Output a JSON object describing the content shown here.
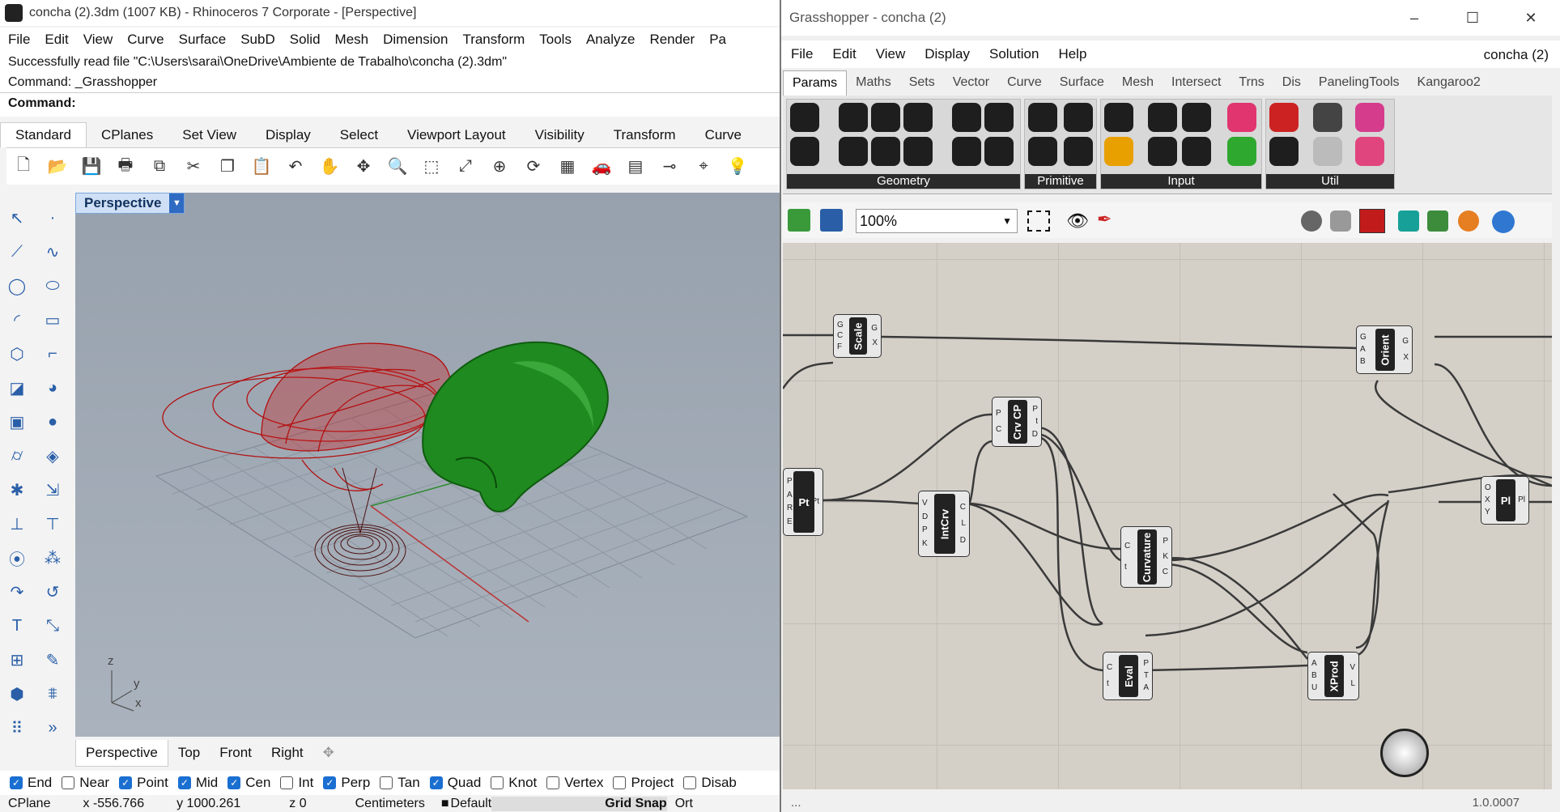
{
  "rhino": {
    "title": "concha (2).3dm (1007 KB) - Rhinoceros 7 Corporate - [Perspective]",
    "menu": [
      "File",
      "Edit",
      "View",
      "Curve",
      "Surface",
      "SubD",
      "Solid",
      "Mesh",
      "Dimension",
      "Transform",
      "Tools",
      "Analyze",
      "Render",
      "Pa"
    ],
    "command_history": [
      "Successfully read file \"C:\\Users\\sarai\\OneDrive\\Ambiente de Trabalho\\concha (2).3dm\"",
      "Command: _Grasshopper"
    ],
    "command_prompt": "Command:",
    "toolbar_tabs": [
      "Standard",
      "CPlanes",
      "Set View",
      "Display",
      "Select",
      "Viewport Layout",
      "Visibility",
      "Transform",
      "Curve"
    ],
    "toolbar_icons": [
      "new-icon",
      "open-icon",
      "save-icon",
      "print-icon",
      "import-icon",
      "cut-icon",
      "copy-icon",
      "paste-icon",
      "undo-icon",
      "pan-icon",
      "rotate-view-icon",
      "zoom-icon",
      "zoom-window-icon",
      "zoom-extents-icon",
      "zoom-selected-icon",
      "rotate-icon",
      "viewport-layout-icon",
      "car-icon",
      "grid-icon",
      "dimension-icon",
      "snap-icon",
      "light-icon"
    ],
    "viewport_label": "Perspective",
    "axis_labels": {
      "z": "z",
      "y": "y",
      "x": "x"
    },
    "view_tabs": [
      "Perspective",
      "Top",
      "Front",
      "Right"
    ],
    "osnaps": [
      {
        "label": "End",
        "checked": true
      },
      {
        "label": "Near",
        "checked": false
      },
      {
        "label": "Point",
        "checked": true
      },
      {
        "label": "Mid",
        "checked": true
      },
      {
        "label": "Cen",
        "checked": true
      },
      {
        "label": "Int",
        "checked": false
      },
      {
        "label": "Perp",
        "checked": true
      },
      {
        "label": "Tan",
        "checked": false
      },
      {
        "label": "Quad",
        "checked": true
      },
      {
        "label": "Knot",
        "checked": false
      },
      {
        "label": "Vertex",
        "checked": false
      },
      {
        "label": "Project",
        "checked": false
      },
      {
        "label": "Disab",
        "checked": false
      }
    ],
    "status": {
      "cplane": "CPlane",
      "x": "x -556.766",
      "y": "y 1000.261",
      "z": "z 0",
      "units": "Centimeters",
      "layer": "Default",
      "grid_snap": "Grid Snap",
      "ortho": "Ort"
    }
  },
  "grasshopper": {
    "title": "Grasshopper - concha (2)",
    "window_controls": {
      "minimize": "–",
      "maximize": "☐",
      "close": "✕"
    },
    "menu": [
      "File",
      "Edit",
      "View",
      "Display",
      "Solution",
      "Help"
    ],
    "document_name": "concha (2)",
    "tabs": [
      "Params",
      "Maths",
      "Sets",
      "Vector",
      "Curve",
      "Surface",
      "Mesh",
      "Intersect",
      "Trns",
      "Dis",
      "PanelingTools",
      "Kangaroo2"
    ],
    "active_tab": "Params",
    "groups": [
      "Geometry",
      "Primitive",
      "Input",
      "Util"
    ],
    "zoom": "100%",
    "nodes": [
      {
        "id": "scale",
        "label": "Scale",
        "inputs": [
          "G",
          "C",
          "F"
        ],
        "outputs": [
          "G",
          "X"
        ]
      },
      {
        "id": "orient",
        "label": "Orient",
        "inputs": [
          "G",
          "A",
          "B"
        ],
        "outputs": [
          "G",
          "X"
        ]
      },
      {
        "id": "crvcp",
        "label": "Crv CP",
        "inputs": [
          "P",
          "C"
        ],
        "outputs": [
          "P",
          "t",
          "D"
        ]
      },
      {
        "id": "pt",
        "label": "Pt",
        "inputs": [
          "P",
          "A",
          "R",
          "E"
        ],
        "outputs": [
          "Pt"
        ]
      },
      {
        "id": "intcrv",
        "label": "IntCrv",
        "inputs": [
          "V",
          "D",
          "P",
          "K"
        ],
        "outputs": [
          "C",
          "L",
          "D"
        ]
      },
      {
        "id": "curvature",
        "label": "Curvature",
        "inputs": [
          "C",
          "t"
        ],
        "outputs": [
          "P",
          "K",
          "C"
        ]
      },
      {
        "id": "pl",
        "label": "Pl",
        "inputs": [
          "O",
          "X",
          "Y"
        ],
        "outputs": [
          "Pl"
        ]
      },
      {
        "id": "eval",
        "label": "Eval",
        "inputs": [
          "C",
          "t"
        ],
        "outputs": [
          "P",
          "T",
          "A"
        ]
      },
      {
        "id": "xprod",
        "label": "XProd",
        "inputs": [
          "A",
          "B",
          "U"
        ],
        "outputs": [
          "V",
          "L"
        ]
      }
    ],
    "status_left": "...",
    "status_right": "1.0.0007"
  }
}
